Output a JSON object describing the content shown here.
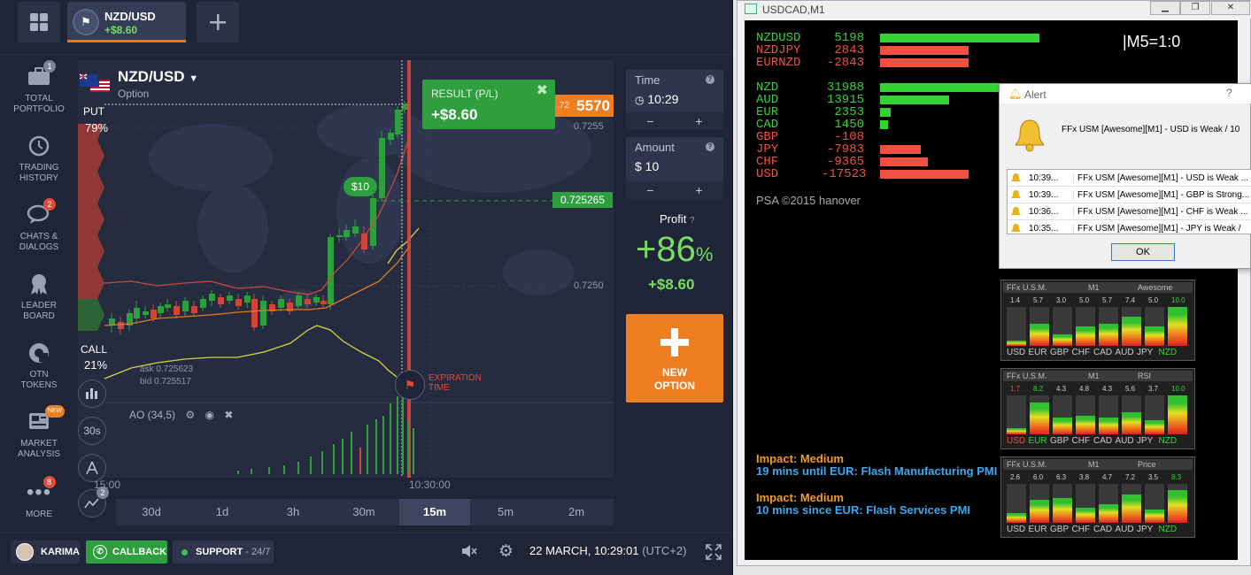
{
  "platform": {
    "asset_tab": {
      "name": "NZD/USD",
      "pl": "+$8.60"
    },
    "sidebar": [
      {
        "label": "TOTAL\nPORTFOLIO",
        "badge": "1",
        "icon": "briefcase-icon"
      },
      {
        "label": "TRADING\nHISTORY",
        "badge": "",
        "icon": "history-icon"
      },
      {
        "label": "CHATS &\nDIALOGS",
        "badge": "2",
        "icon": "chat-icon"
      },
      {
        "label": "LEADER\nBOARD",
        "badge": "",
        "icon": "medal-icon"
      },
      {
        "label": "OTN\nTOKENS",
        "badge": "",
        "icon": "token-icon"
      },
      {
        "label": "MARKET\nANALYSIS",
        "badge": "NEW",
        "icon": "news-icon"
      },
      {
        "label": "MORE",
        "badge": "8",
        "icon": "more-icon"
      }
    ],
    "pair": {
      "name": "NZD/USD",
      "type": "Option"
    },
    "put": {
      "label": "PUT",
      "pct": "79%"
    },
    "call": {
      "label": "CALL",
      "pct": "21%"
    },
    "ask": "ask 0.725623",
    "bid": "bid 0.725517",
    "indicator": "AO (34,5)",
    "result": {
      "title": "RESULT (P/L)",
      "value": "+$8.60"
    },
    "price_tag": {
      "small": ".72",
      "big": "5570"
    },
    "level_tag": "0.725265",
    "y_labels": [
      "0.7255",
      "0.7250"
    ],
    "bubble": "$10",
    "expiration": "EXPIRATION\nTIME",
    "x_labels": [
      "15:00",
      "10:30:00"
    ],
    "timeframes": [
      "30d",
      "1d",
      "3h",
      "30m",
      "15m",
      "5m",
      "2m"
    ],
    "active_timeframe": "15m",
    "tools": [
      "chart-type-icon",
      "30s",
      "drawing-icon",
      "indicators-icon"
    ],
    "tools_badge": "2",
    "time": {
      "label": "Time",
      "value": "10:29"
    },
    "amount": {
      "label": "Amount",
      "value": "$ 10"
    },
    "profit": {
      "label": "Profit",
      "pct": "+86",
      "pct_sign": "%",
      "value": "+$8.60"
    },
    "new_option": "NEW\nOPTION",
    "bottom": {
      "agent": "KARIMA",
      "callback": "CALLBACK",
      "support": "SUPPORT",
      "support_sub": "- 24/7",
      "datetime": "22 MARCH, 10:29:01",
      "timezone": "(UTC+2)"
    },
    "colors": {
      "green": "#2f9e3e",
      "red": "#e04a3a",
      "orange": "#ef7d22",
      "bg": "#1f2537"
    }
  },
  "mt4": {
    "title": "USDCAD,M1",
    "pairs": [
      {
        "name": "NZDUSD",
        "value": "5198",
        "color": "#34d334",
        "bar": 180
      },
      {
        "name": "NZDJPY",
        "value": "2843",
        "color": "#f25040",
        "bar": 100
      },
      {
        "name": "EURNZD",
        "value": "-2843",
        "color": "#f25040",
        "bar": 100
      }
    ],
    "currencies": [
      {
        "name": "NZD",
        "value": "31988",
        "color": "#34d334",
        "bar": 140
      },
      {
        "name": "AUD",
        "value": "13915",
        "color": "#34d334",
        "bar": 78
      },
      {
        "name": "EUR",
        "value": "2353",
        "color": "#34d334",
        "bar": 12
      },
      {
        "name": "CAD",
        "value": "1450",
        "color": "#34d334",
        "bar": 9
      },
      {
        "name": "GBP",
        "value": "-108",
        "color": "#f25040",
        "bar": 0
      },
      {
        "name": "JPY",
        "value": "-7983",
        "color": "#f25040",
        "bar": 46
      },
      {
        "name": "CHF",
        "value": "-9365",
        "color": "#f25040",
        "bar": 54
      },
      {
        "name": "USD",
        "value": "-17523",
        "color": "#f25040",
        "bar": 100
      }
    ],
    "m5": "|M5=1:0",
    "copyright": "PSA ©2015 hanover",
    "news": [
      {
        "impact": "Impact: Medium",
        "text": "19 mins until EUR: Flash Manufacturing PMI"
      },
      {
        "impact": "Impact: Medium",
        "text": "10 mins since EUR: Flash Services PMI"
      }
    ],
    "meters": [
      {
        "title": "FFx U.S.M.",
        "tf": "M1",
        "mode": "Awesome",
        "nums": [
          "1.4",
          "5.7",
          "3.0",
          "5.0",
          "5.7",
          "7.4",
          "5.0",
          "10.0"
        ],
        "names": [
          "USD",
          "EUR",
          "GBP",
          "CHF",
          "CAD",
          "AUD",
          "JPY",
          "NZD"
        ]
      },
      {
        "title": "FFx U.S.M.",
        "tf": "M1",
        "mode": "RSI",
        "nums": [
          "1.7",
          "8.2",
          "4.3",
          "4.8",
          "4.3",
          "5.6",
          "3.7",
          "10.0"
        ],
        "names": [
          "USD",
          "EUR",
          "GBP",
          "CHF",
          "CAD",
          "AUD",
          "JPY",
          "NZD"
        ]
      },
      {
        "title": "FFx U.S.M.",
        "tf": "M1",
        "mode": "Price",
        "nums": [
          "2.6",
          "6.0",
          "6.3",
          "3.8",
          "4.7",
          "7.2",
          "3.5",
          "8.3"
        ],
        "names": [
          "USD",
          "EUR",
          "GBP",
          "CHF",
          "CAD",
          "AUD",
          "JPY",
          "NZD"
        ]
      }
    ],
    "alert": {
      "title": "Alert",
      "help": "?",
      "message": "FFx USM [Awesome][M1] - USD is Weak / 10",
      "rows": [
        {
          "time": "10:39...",
          "text": "FFx USM [Awesome][M1] - USD is Weak ..."
        },
        {
          "time": "10:39...",
          "text": "FFx USM [Awesome][M1] - GBP is Strong..."
        },
        {
          "time": "10:36...",
          "text": "FFx USM [Awesome][M1] - CHF is Weak ..."
        },
        {
          "time": "10:35...",
          "text": "FFx USM [Awesome][M1] - JPY is Weak /"
        }
      ],
      "ok": "OK"
    }
  }
}
